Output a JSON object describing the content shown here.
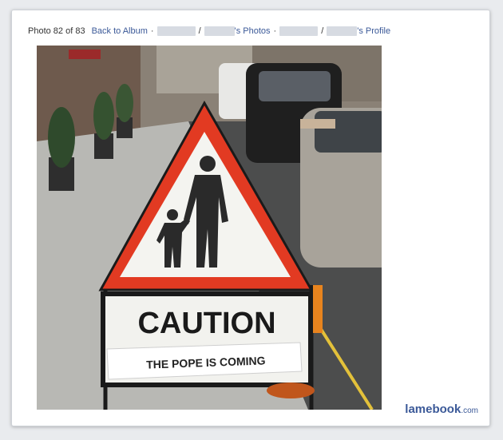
{
  "nav": {
    "photo_counter": "Photo 82 of 83",
    "back_to_album": "Back to Album",
    "photos_suffix": "'s Photos",
    "profile_suffix": "'s Profile",
    "dot": "·",
    "slash": "/"
  },
  "photo": {
    "sign_caution": "CAUTION",
    "sign_note": "THE POPE IS COMING"
  },
  "watermark": {
    "brand": "lamebook",
    "tld": ".com"
  },
  "colors": {
    "link": "#3b5998",
    "sign_red": "#e23a22",
    "pavement": "#b8b8b4"
  }
}
